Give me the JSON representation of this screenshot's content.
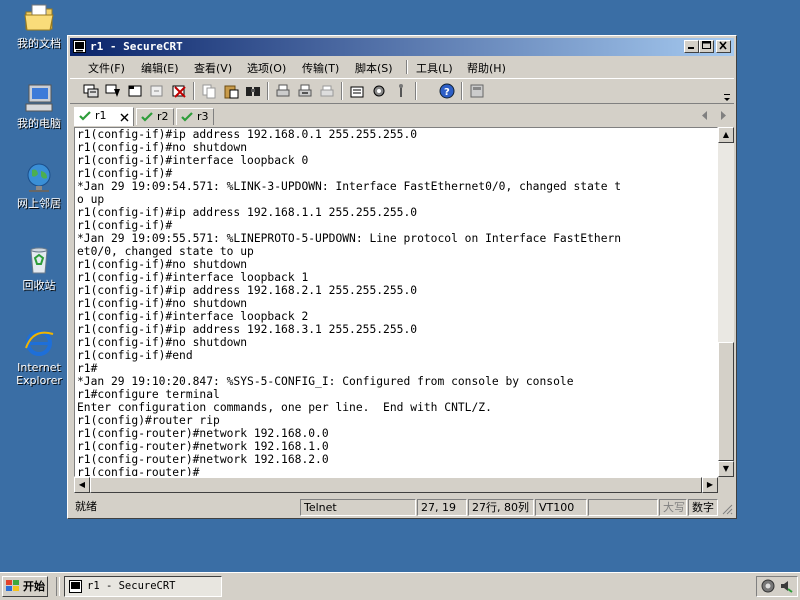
{
  "desktop": {
    "icons": [
      {
        "label": "我的文档",
        "icon": "my-documents-icon"
      },
      {
        "label": "我的电脑",
        "icon": "my-computer-icon"
      },
      {
        "label": "网上邻居",
        "icon": "network-places-icon"
      },
      {
        "label": "回收站",
        "icon": "recycle-bin-icon"
      },
      {
        "label": "Internet Explorer",
        "icon": "internet-explorer-icon"
      }
    ]
  },
  "window": {
    "title": "r1 - SecureCRT",
    "menu": [
      "文件(F)",
      "编辑(E)",
      "查看(V)",
      "选项(O)",
      "传输(T)",
      "脚本(S)",
      "工具(L)",
      "帮助(H)"
    ],
    "tabs": [
      {
        "label": "r1",
        "active": true
      },
      {
        "label": "r2",
        "active": false
      },
      {
        "label": "r3",
        "active": false
      }
    ],
    "terminal_lines": [
      "r1(config-if)#ip address 192.168.0.1 255.255.255.0",
      "r1(config-if)#no shutdown",
      "r1(config-if)#interface loopback 0",
      "r1(config-if)#",
      "*Jan 29 19:09:54.571: %LINK-3-UPDOWN: Interface FastEthernet0/0, changed state t",
      "o up",
      "r1(config-if)#ip address 192.168.1.1 255.255.255.0",
      "r1(config-if)#",
      "*Jan 29 19:09:55.571: %LINEPROTO-5-UPDOWN: Line protocol on Interface FastEthern",
      "et0/0, changed state to up",
      "r1(config-if)#no shutdown",
      "r1(config-if)#interface loopback 1",
      "r1(config-if)#ip address 192.168.2.1 255.255.255.0",
      "r1(config-if)#no shutdown",
      "r1(config-if)#interface loopback 2",
      "r1(config-if)#ip address 192.168.3.1 255.255.255.0",
      "r1(config-if)#no shutdown",
      "r1(config-if)#end",
      "r1#",
      "*Jan 29 19:10:20.847: %SYS-5-CONFIG_I: Configured from console by console",
      "r1#configure terminal",
      "Enter configuration commands, one per line.  End with CNTL/Z.",
      "r1(config)#router rip",
      "r1(config-router)#network 192.168.0.0",
      "r1(config-router)#network 192.168.1.0",
      "r1(config-router)#network 192.168.2.0",
      "r1(config-router)#"
    ],
    "status": {
      "ready": "就绪",
      "protocol": "Telnet",
      "cursor": "27, 19",
      "size": "27行, 80列",
      "emulation": "VT100",
      "caps": "大写",
      "num": "数字"
    }
  },
  "taskbar": {
    "start_label": "开始",
    "items": [
      {
        "label": "r1 - SecureCRT"
      }
    ]
  }
}
